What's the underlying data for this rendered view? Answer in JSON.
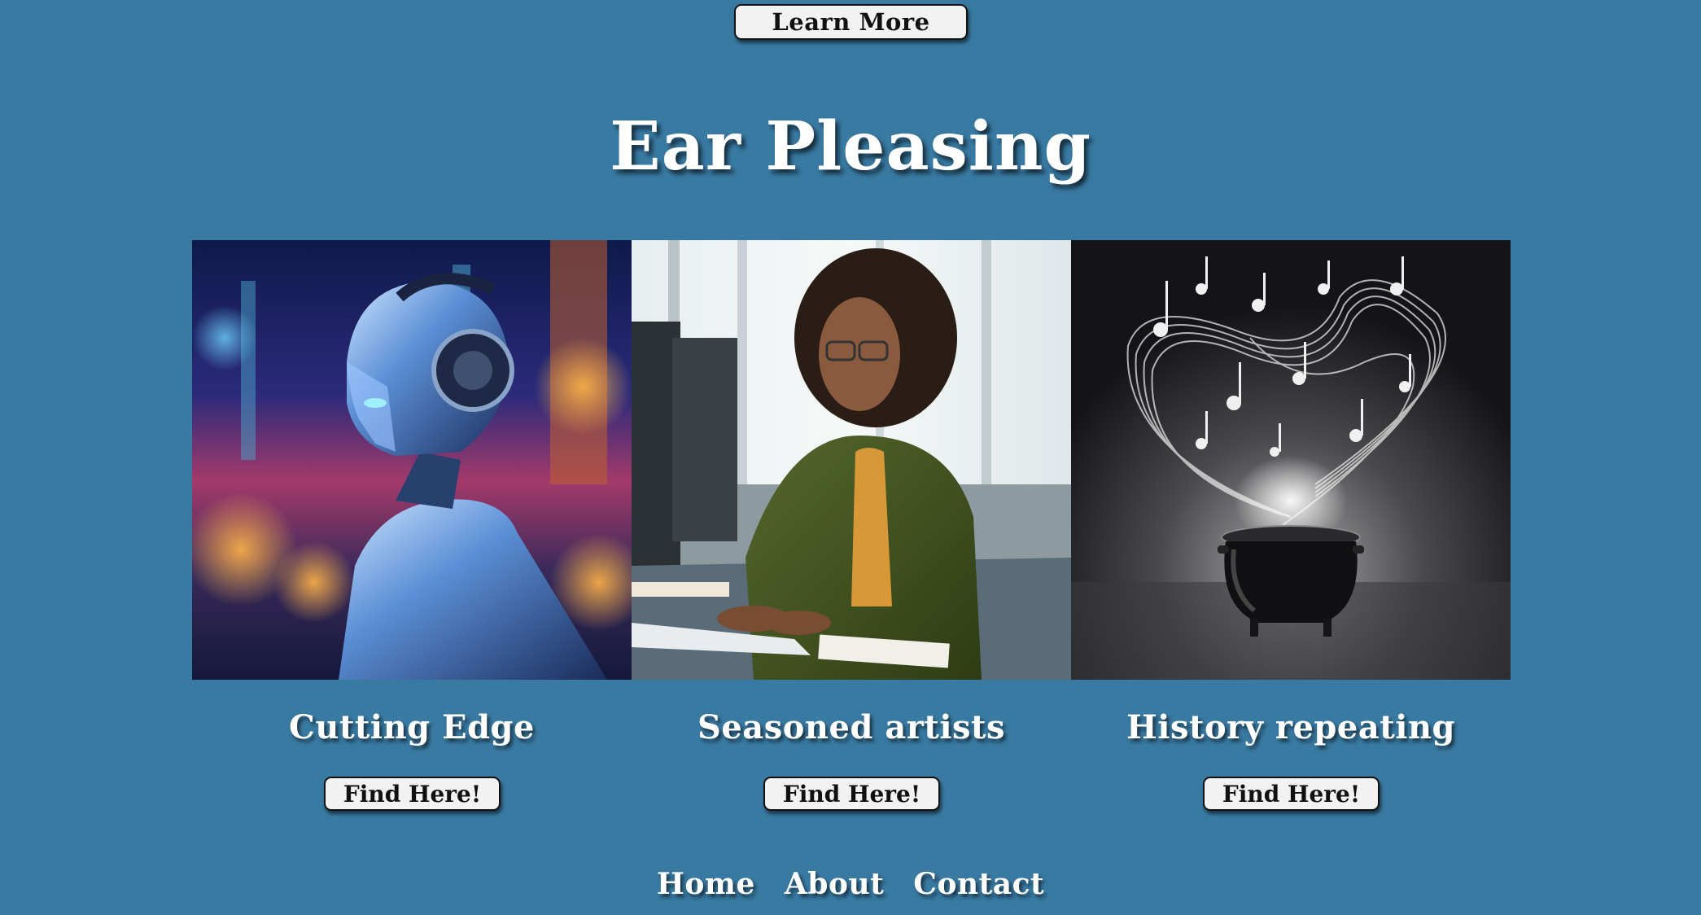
{
  "header": {
    "learn_more_label": "Learn More",
    "title": "Ear Pleasing"
  },
  "cards": [
    {
      "caption": "Cutting Edge",
      "button_label": "Find Here!",
      "image": "robot-with-headphones"
    },
    {
      "caption": "Seasoned artists",
      "button_label": "Find Here!",
      "image": "woman-typing-at-computer"
    },
    {
      "caption": "History repeating",
      "button_label": "Find Here!",
      "image": "cauldron-with-music-notes"
    }
  ],
  "footer": {
    "nav": [
      {
        "label": "Home"
      },
      {
        "label": "About"
      },
      {
        "label": "Contact"
      }
    ]
  },
  "colors": {
    "background": "#397aa3",
    "button_bg": "#f2f2f2",
    "text": "#ffffff"
  }
}
